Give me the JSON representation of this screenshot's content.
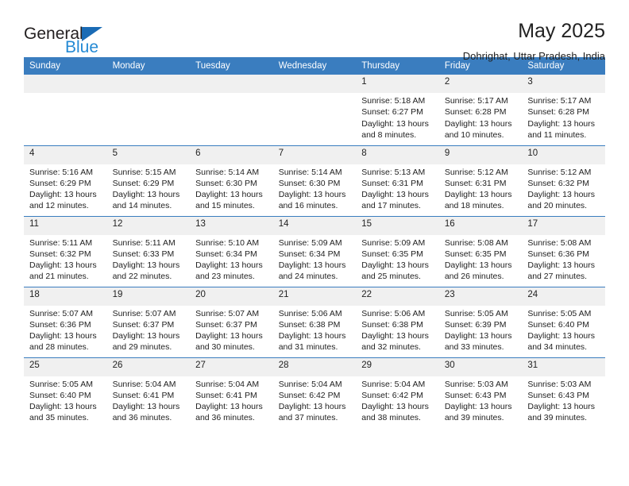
{
  "brand": {
    "word1": "General",
    "word2": "Blue",
    "flag_color": "#1a6bb5",
    "blue_color": "#2389d4"
  },
  "header": {
    "title": "May 2025",
    "subtitle": "Dohrighat, Uttar Pradesh, India"
  },
  "calendar": {
    "header_bg": "#3a7dbf",
    "daynum_bg": "#f0f0f0",
    "weekdays": [
      "Sunday",
      "Monday",
      "Tuesday",
      "Wednesday",
      "Thursday",
      "Friday",
      "Saturday"
    ],
    "weeks": [
      [
        {
          "day": "",
          "lines": []
        },
        {
          "day": "",
          "lines": []
        },
        {
          "day": "",
          "lines": []
        },
        {
          "day": "",
          "lines": []
        },
        {
          "day": "1",
          "lines": [
            "Sunrise: 5:18 AM",
            "Sunset: 6:27 PM",
            "Daylight: 13 hours",
            "and 8 minutes."
          ]
        },
        {
          "day": "2",
          "lines": [
            "Sunrise: 5:17 AM",
            "Sunset: 6:28 PM",
            "Daylight: 13 hours",
            "and 10 minutes."
          ]
        },
        {
          "day": "3",
          "lines": [
            "Sunrise: 5:17 AM",
            "Sunset: 6:28 PM",
            "Daylight: 13 hours",
            "and 11 minutes."
          ]
        }
      ],
      [
        {
          "day": "4",
          "lines": [
            "Sunrise: 5:16 AM",
            "Sunset: 6:29 PM",
            "Daylight: 13 hours",
            "and 12 minutes."
          ]
        },
        {
          "day": "5",
          "lines": [
            "Sunrise: 5:15 AM",
            "Sunset: 6:29 PM",
            "Daylight: 13 hours",
            "and 14 minutes."
          ]
        },
        {
          "day": "6",
          "lines": [
            "Sunrise: 5:14 AM",
            "Sunset: 6:30 PM",
            "Daylight: 13 hours",
            "and 15 minutes."
          ]
        },
        {
          "day": "7",
          "lines": [
            "Sunrise: 5:14 AM",
            "Sunset: 6:30 PM",
            "Daylight: 13 hours",
            "and 16 minutes."
          ]
        },
        {
          "day": "8",
          "lines": [
            "Sunrise: 5:13 AM",
            "Sunset: 6:31 PM",
            "Daylight: 13 hours",
            "and 17 minutes."
          ]
        },
        {
          "day": "9",
          "lines": [
            "Sunrise: 5:12 AM",
            "Sunset: 6:31 PM",
            "Daylight: 13 hours",
            "and 18 minutes."
          ]
        },
        {
          "day": "10",
          "lines": [
            "Sunrise: 5:12 AM",
            "Sunset: 6:32 PM",
            "Daylight: 13 hours",
            "and 20 minutes."
          ]
        }
      ],
      [
        {
          "day": "11",
          "lines": [
            "Sunrise: 5:11 AM",
            "Sunset: 6:32 PM",
            "Daylight: 13 hours",
            "and 21 minutes."
          ]
        },
        {
          "day": "12",
          "lines": [
            "Sunrise: 5:11 AM",
            "Sunset: 6:33 PM",
            "Daylight: 13 hours",
            "and 22 minutes."
          ]
        },
        {
          "day": "13",
          "lines": [
            "Sunrise: 5:10 AM",
            "Sunset: 6:34 PM",
            "Daylight: 13 hours",
            "and 23 minutes."
          ]
        },
        {
          "day": "14",
          "lines": [
            "Sunrise: 5:09 AM",
            "Sunset: 6:34 PM",
            "Daylight: 13 hours",
            "and 24 minutes."
          ]
        },
        {
          "day": "15",
          "lines": [
            "Sunrise: 5:09 AM",
            "Sunset: 6:35 PM",
            "Daylight: 13 hours",
            "and 25 minutes."
          ]
        },
        {
          "day": "16",
          "lines": [
            "Sunrise: 5:08 AM",
            "Sunset: 6:35 PM",
            "Daylight: 13 hours",
            "and 26 minutes."
          ]
        },
        {
          "day": "17",
          "lines": [
            "Sunrise: 5:08 AM",
            "Sunset: 6:36 PM",
            "Daylight: 13 hours",
            "and 27 minutes."
          ]
        }
      ],
      [
        {
          "day": "18",
          "lines": [
            "Sunrise: 5:07 AM",
            "Sunset: 6:36 PM",
            "Daylight: 13 hours",
            "and 28 minutes."
          ]
        },
        {
          "day": "19",
          "lines": [
            "Sunrise: 5:07 AM",
            "Sunset: 6:37 PM",
            "Daylight: 13 hours",
            "and 29 minutes."
          ]
        },
        {
          "day": "20",
          "lines": [
            "Sunrise: 5:07 AM",
            "Sunset: 6:37 PM",
            "Daylight: 13 hours",
            "and 30 minutes."
          ]
        },
        {
          "day": "21",
          "lines": [
            "Sunrise: 5:06 AM",
            "Sunset: 6:38 PM",
            "Daylight: 13 hours",
            "and 31 minutes."
          ]
        },
        {
          "day": "22",
          "lines": [
            "Sunrise: 5:06 AM",
            "Sunset: 6:38 PM",
            "Daylight: 13 hours",
            "and 32 minutes."
          ]
        },
        {
          "day": "23",
          "lines": [
            "Sunrise: 5:05 AM",
            "Sunset: 6:39 PM",
            "Daylight: 13 hours",
            "and 33 minutes."
          ]
        },
        {
          "day": "24",
          "lines": [
            "Sunrise: 5:05 AM",
            "Sunset: 6:40 PM",
            "Daylight: 13 hours",
            "and 34 minutes."
          ]
        }
      ],
      [
        {
          "day": "25",
          "lines": [
            "Sunrise: 5:05 AM",
            "Sunset: 6:40 PM",
            "Daylight: 13 hours",
            "and 35 minutes."
          ]
        },
        {
          "day": "26",
          "lines": [
            "Sunrise: 5:04 AM",
            "Sunset: 6:41 PM",
            "Daylight: 13 hours",
            "and 36 minutes."
          ]
        },
        {
          "day": "27",
          "lines": [
            "Sunrise: 5:04 AM",
            "Sunset: 6:41 PM",
            "Daylight: 13 hours",
            "and 36 minutes."
          ]
        },
        {
          "day": "28",
          "lines": [
            "Sunrise: 5:04 AM",
            "Sunset: 6:42 PM",
            "Daylight: 13 hours",
            "and 37 minutes."
          ]
        },
        {
          "day": "29",
          "lines": [
            "Sunrise: 5:04 AM",
            "Sunset: 6:42 PM",
            "Daylight: 13 hours",
            "and 38 minutes."
          ]
        },
        {
          "day": "30",
          "lines": [
            "Sunrise: 5:03 AM",
            "Sunset: 6:43 PM",
            "Daylight: 13 hours",
            "and 39 minutes."
          ]
        },
        {
          "day": "31",
          "lines": [
            "Sunrise: 5:03 AM",
            "Sunset: 6:43 PM",
            "Daylight: 13 hours",
            "and 39 minutes."
          ]
        }
      ]
    ]
  }
}
